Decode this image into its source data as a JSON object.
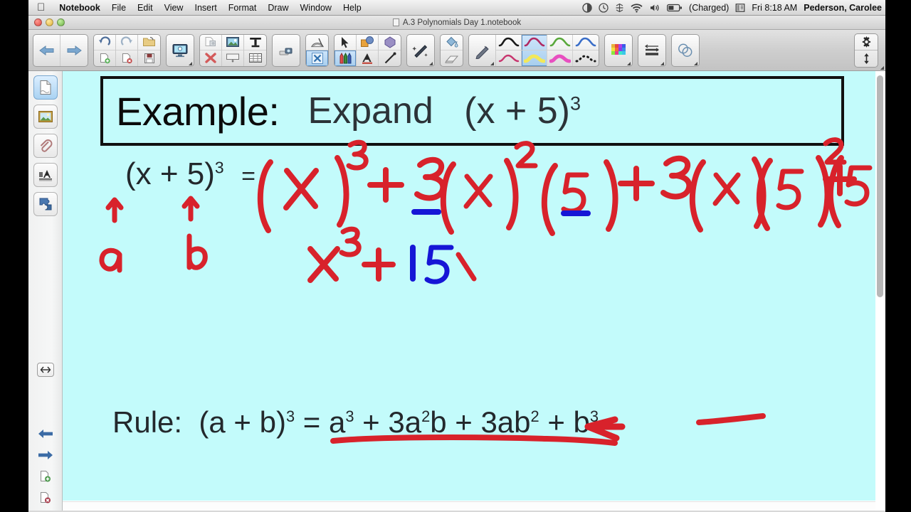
{
  "menubar": {
    "apple_icon": "apple-logo",
    "items": [
      {
        "label": "Notebook",
        "bold": true
      },
      {
        "label": "File"
      },
      {
        "label": "Edit"
      },
      {
        "label": "View"
      },
      {
        "label": "Insert"
      },
      {
        "label": "Format"
      },
      {
        "label": "Draw"
      },
      {
        "label": "Window"
      },
      {
        "label": "Help"
      }
    ],
    "status": {
      "icons": [
        "screen-record-icon",
        "time-machine-icon",
        "dropbox-icon",
        "wifi-icon",
        "volume-icon",
        "battery-icon",
        "input-source-icon"
      ],
      "battery_label": "(Charged)",
      "clock": "Fri 8:18 AM",
      "user": "Pederson, Carolee",
      "search_icon": "search-icon"
    }
  },
  "window": {
    "title": "A.3 Polynomials Day 1.notebook",
    "doc_icon": "document-icon",
    "traffic": {
      "close": "close-button",
      "minimize": "minimize-button",
      "zoom": "zoom-button"
    }
  },
  "toolbar": {
    "groups": [
      {
        "name": "navigation",
        "buttons": [
          "previous-page-button",
          "next-page-button"
        ]
      },
      {
        "name": "file-actions",
        "buttons": [
          "undo-button",
          "redo-button",
          "open-file-button",
          "new-page-button",
          "delete-page-button",
          "save-button"
        ]
      },
      {
        "name": "screen-capture",
        "buttons": [
          "screen-capture-button"
        ]
      },
      {
        "name": "insert",
        "buttons": [
          "clear-page-button",
          "delete-selection-button",
          "insert-image-button",
          "insert-screen-shade-button",
          "insert-text-button",
          "insert-table-button"
        ]
      },
      {
        "name": "document-camera",
        "buttons": [
          "document-camera-button"
        ]
      },
      {
        "name": "measurement",
        "buttons": [
          "measurement-tools-button",
          "close-tool-button"
        ]
      },
      {
        "name": "select-tools",
        "buttons": [
          "select-arrow-button",
          "shapes-button",
          "shape-fill-button",
          "pens-button",
          "text-tool-button",
          "line-tool-button"
        ]
      },
      {
        "name": "magic-pen",
        "buttons": [
          "magic-pen-button"
        ]
      },
      {
        "name": "fill-erase",
        "buttons": [
          "paint-bucket-button",
          "eraser-button"
        ]
      },
      {
        "name": "pen-picker",
        "buttons": [
          "pen-tool-button"
        ]
      },
      {
        "name": "pen-styles",
        "selected_index": 1,
        "swatches": [
          "pen-style-black",
          "pen-style-magenta-selected",
          "pen-style-green",
          "pen-style-blue",
          "pen-style-red",
          "pen-style-yellow-highlighter",
          "pen-style-pink-highlighter",
          "pen-style-dashed"
        ]
      },
      {
        "name": "line-color",
        "buttons": [
          "color-palette-button"
        ]
      },
      {
        "name": "line-properties",
        "buttons": [
          "line-properties-button"
        ]
      },
      {
        "name": "transparency",
        "buttons": [
          "transparency-button"
        ]
      }
    ],
    "right_controls": [
      "customize-toolbar-gear",
      "move-toolbar-arrows"
    ]
  },
  "sidebar": {
    "top_items": [
      {
        "name": "page-sorter",
        "icon": "page-thumbnail-icon",
        "active": true
      },
      {
        "name": "gallery",
        "icon": "picture-frame-icon",
        "active": false
      },
      {
        "name": "attachments",
        "icon": "paperclip-icon",
        "active": false
      },
      {
        "name": "properties",
        "icon": "properties-icon",
        "active": false
      },
      {
        "name": "add-ons",
        "icon": "puzzle-piece-icon",
        "active": false
      }
    ],
    "bottom_items": [
      {
        "name": "auto-hide-toggle",
        "icon": "horizontal-resize-icon"
      },
      {
        "name": "previous-page",
        "icon": "left-arrow-icon"
      },
      {
        "name": "next-page",
        "icon": "right-arrow-icon"
      },
      {
        "name": "add-page",
        "icon": "add-page-icon"
      },
      {
        "name": "delete-page",
        "icon": "delete-page-icon"
      }
    ]
  },
  "slide": {
    "background_color": "#c3fbfb",
    "title_box": {
      "label": "Example:",
      "prompt": "Expand",
      "expression_base": "(x + 5)",
      "expression_exponent": "3",
      "border_color": "#101010"
    },
    "work_line": {
      "lhs_base": "(x + 5)",
      "lhs_exponent": "3",
      "equals": "=",
      "rhs_handwritten": "(x)3 + 3(x)2(5) + 3(x)(5)2 + (5)3",
      "ink_color": "#d8222b"
    },
    "annotations": {
      "label_a": "a",
      "label_b": "b",
      "arrow_a": "up-arrow-annotation",
      "arrow_b": "up-arrow-annotation",
      "underline_color": "#1616d6",
      "underlined_terms": [
        "3",
        "5"
      ]
    },
    "second_line": {
      "red_part": "x3 +",
      "blue_part": "15",
      "red_color": "#d8222b",
      "blue_color": "#1616d6"
    },
    "rule_line": {
      "label": "Rule:",
      "lhs_base": "(a + b)",
      "lhs_exponent": "3",
      "equals": "=",
      "terms": [
        "a3",
        "+",
        "3a2b",
        "+",
        "3ab2",
        "+",
        "b3"
      ],
      "underline_color": "#d8222b",
      "arrow": "left-arrow-annotation"
    }
  }
}
